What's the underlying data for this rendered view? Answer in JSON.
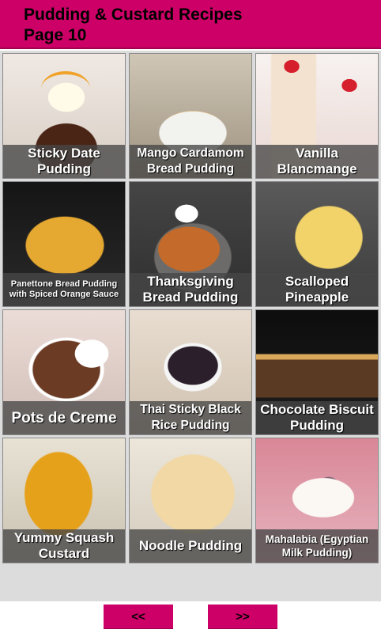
{
  "header": {
    "title_line1": "Pudding & Custard Recipes",
    "title_line2": "Page 10",
    "background": "#cc0066"
  },
  "recipes": [
    {
      "label": "Sticky Date Pudding"
    },
    {
      "label": "Mango Cardamom Bread Pudding"
    },
    {
      "label": "Vanilla Blancmange"
    },
    {
      "label": "Panettone Bread Pudding with Spiced Orange Sauce"
    },
    {
      "label": "Thanksgiving Bread Pudding"
    },
    {
      "label": "Scalloped Pineapple"
    },
    {
      "label": "Pots de Creme"
    },
    {
      "label": "Thai Sticky Black Rice Pudding"
    },
    {
      "label": "Chocolate Biscuit Pudding"
    },
    {
      "label": "Yummy Squash Custard"
    },
    {
      "label": "Noodle Pudding"
    },
    {
      "label": "Mahalabia (Egyptian Milk Pudding)"
    }
  ],
  "nav": {
    "prev_label": "<<",
    "next_label": ">>"
  }
}
